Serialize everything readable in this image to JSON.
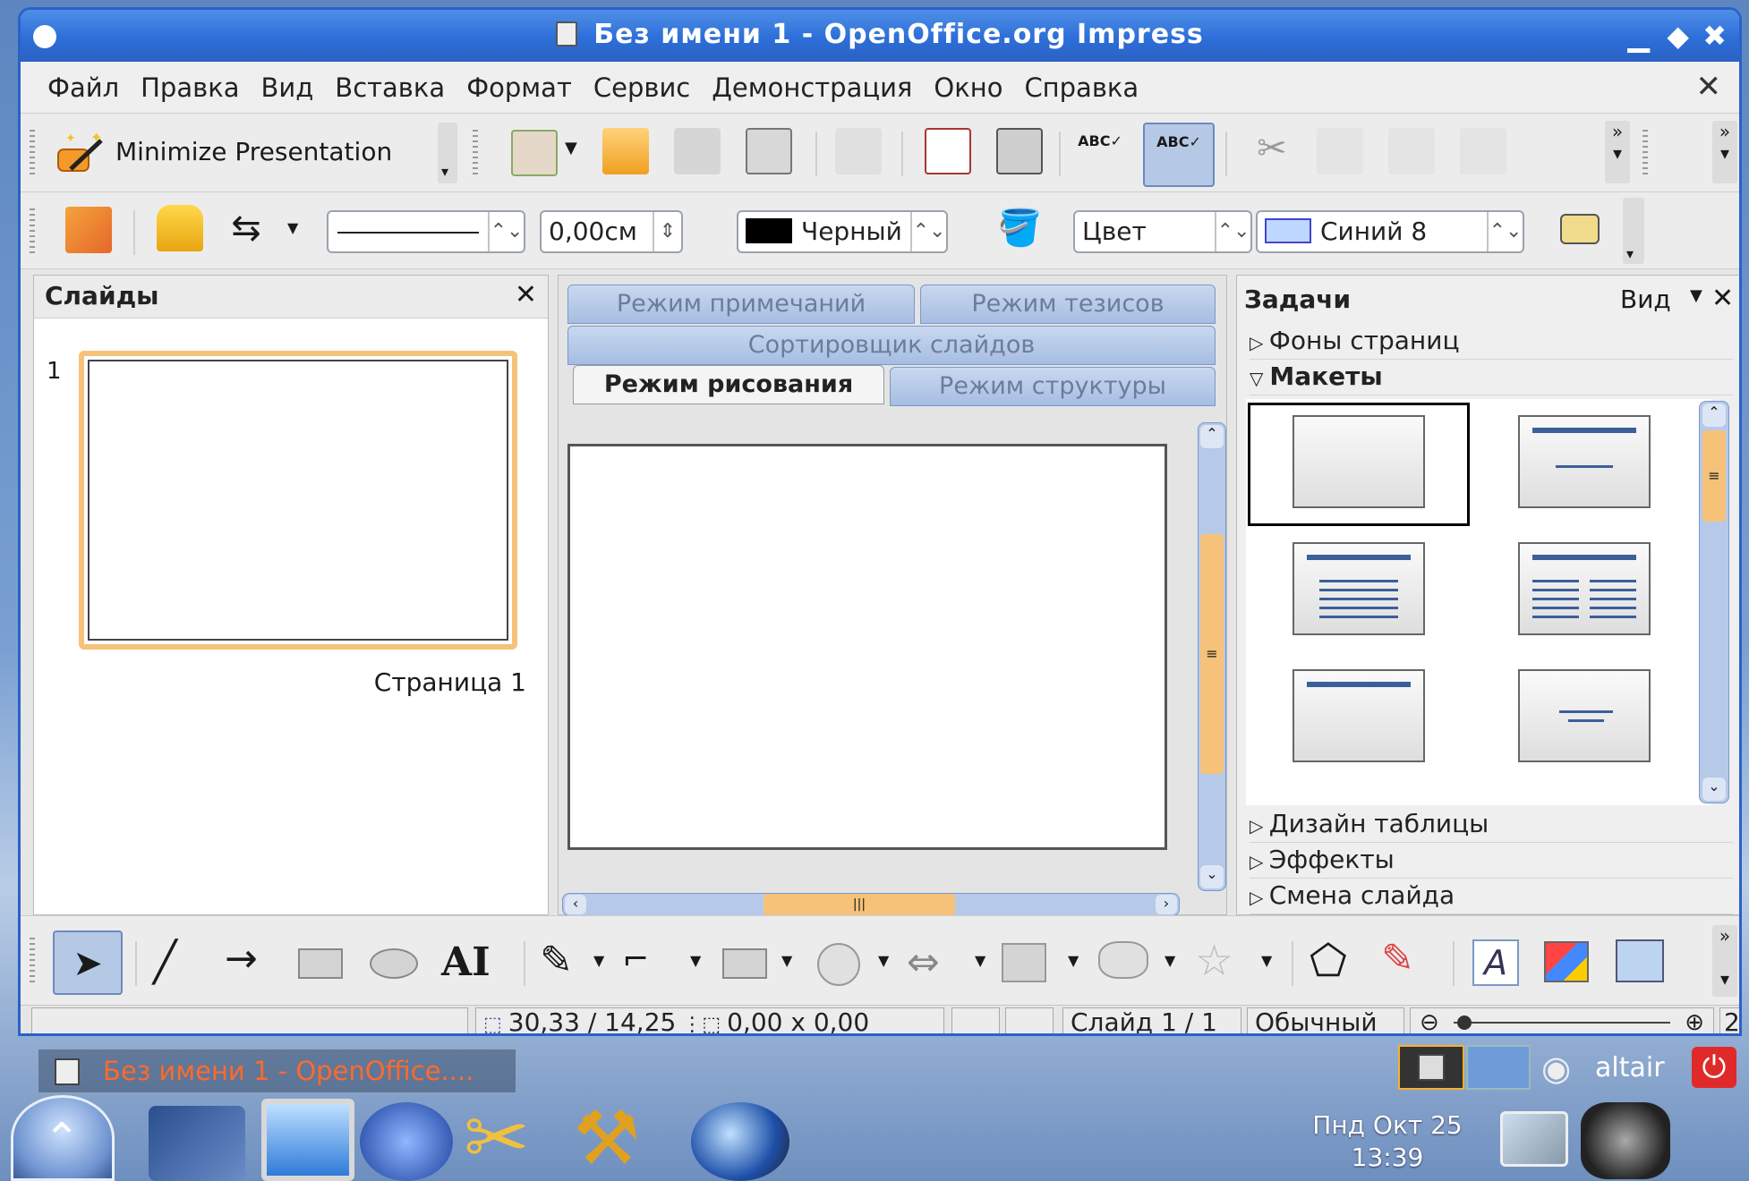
{
  "window": {
    "title": "Без имени 1 - OpenOffice.org Impress"
  },
  "menu": [
    "Файл",
    "Правка",
    "Вид",
    "Вставка",
    "Формат",
    "Сервис",
    "Демонстрация",
    "Окно",
    "Справка"
  ],
  "toolbar": {
    "minimize_label": "Minimize Presentation",
    "line_width_value": "0,00см",
    "line_color_value": "Черный",
    "area_style_value": "Цвет",
    "area_fill_value": "Синий 8",
    "colors": {
      "line_color_swatch": "#000000",
      "fill_swatch": "#bdd7ff",
      "shadow_swatch": "#f0dc8c"
    }
  },
  "slides_pane": {
    "title": "Слайды",
    "slide_number": "1",
    "slide_caption": "Страница 1"
  },
  "view_tabs": {
    "notes": "Режим примечаний",
    "handout": "Режим тезисов",
    "sorter": "Сортировщик слайдов",
    "drawing": "Режим рисования",
    "outline": "Режим структуры"
  },
  "tasks_pane": {
    "title": "Задачи",
    "view_menu": "Вид",
    "sections": {
      "master_pages": "Фоны страниц",
      "layouts": "Макеты",
      "table_design": "Дизайн таблицы",
      "effects": "Эффекты",
      "slide_transition": "Смена слайда"
    }
  },
  "drawing_toolbar": {
    "fontwork_label": "AI"
  },
  "statusbar": {
    "position": "30,33 / 14,25",
    "size": "0,00 x 0,00",
    "slide": "Слайд 1 / 1",
    "layout": "Обычный",
    "zoom_edge": "2"
  },
  "taskbar": {
    "app_button": "Без имени 1 - OpenOffice....",
    "user": "altair",
    "clock_date": "Пнд Окт 25",
    "clock_time": "13:39"
  }
}
